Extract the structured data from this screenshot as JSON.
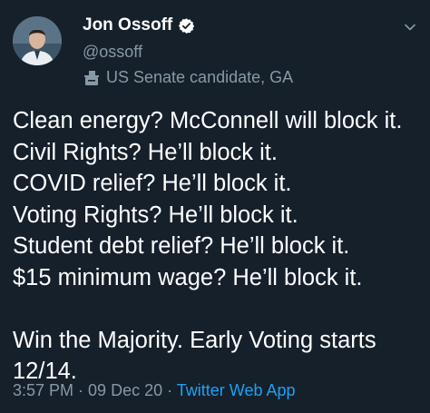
{
  "user": {
    "display_name": "Jon Ossoff",
    "handle": "@ossoff",
    "label": "US Senate candidate, GA"
  },
  "tweet": {
    "lines": [
      "Clean energy? McConnell will block it.",
      "Civil Rights? He’ll block it.",
      "COVID relief? He’ll block it.",
      "Voting Rights? He’ll block it.",
      "Student debt relief? He’ll block it.",
      "$15 minimum wage? He’ll block it."
    ],
    "closing_lines": [
      "Win the Majority. Early Voting starts",
      "12/14."
    ]
  },
  "meta": {
    "time": "3:57 PM",
    "sep1": " · ",
    "date": "09 Dec 20",
    "sep2": " · ",
    "source": "Twitter Web App"
  },
  "colors": {
    "background": "#15202b",
    "text": "#ffffff",
    "secondary": "#8899a6",
    "accent": "#1da1f2"
  },
  "icons": {
    "verified": "verified-badge-icon",
    "chevron": "chevron-down-icon",
    "label": "ballot-box-icon"
  }
}
